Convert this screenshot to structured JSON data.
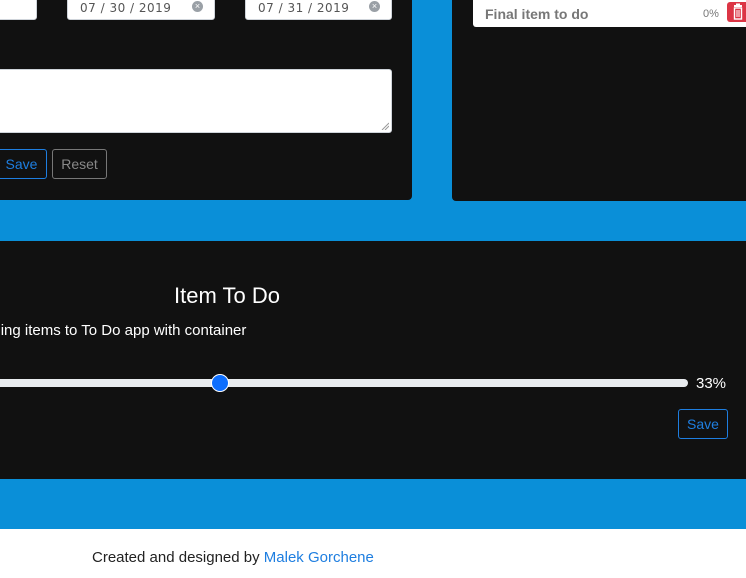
{
  "form": {
    "start_date": "07 / 30 / 2019",
    "end_date": "07 / 31 / 2019",
    "save_label": "Save",
    "reset_label": "Reset"
  },
  "list": {
    "items": [
      {
        "label": "Final item to do",
        "progress_text": "0%",
        "progress": 0
      }
    ]
  },
  "item": {
    "title": "Item To Do",
    "description": "Adding items to To Do app with container",
    "progress_text": "33%",
    "progress": 33,
    "save_label": "Save"
  },
  "footer": {
    "prefix": "Created and designed by ",
    "author": "Malek Gorchene"
  },
  "colors": {
    "background": "#0a8fd8",
    "panel": "#111111",
    "accent": "#1e7ee0",
    "danger": "#dc3545"
  }
}
